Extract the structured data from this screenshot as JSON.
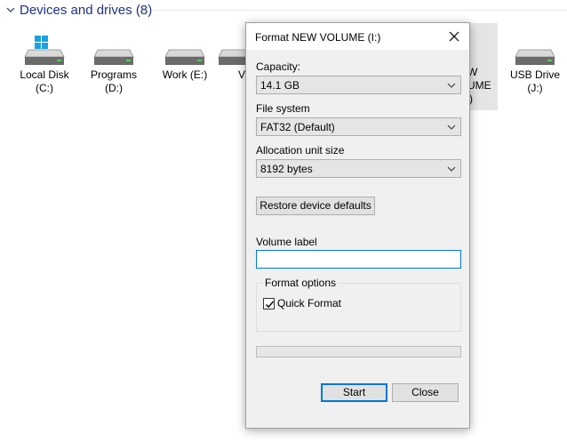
{
  "explorer": {
    "section_title": "Devices and drives (8)",
    "drives": [
      {
        "name": "Local Disk",
        "letter": "(C:)"
      },
      {
        "name": "Programs",
        "letter": "(D:)"
      },
      {
        "name": "Work (E:)",
        "letter": ""
      },
      {
        "name": "Vi",
        "letter": ""
      },
      {
        "name": "W",
        "letter": "UME",
        "extra": ")"
      },
      {
        "name": "USB Drive",
        "letter": "(J:)"
      }
    ]
  },
  "dialog": {
    "title": "Format NEW VOLUME (I:)",
    "capacity_label": "Capacity:",
    "capacity_value": "14.1 GB",
    "filesystem_label": "File system",
    "filesystem_value": "FAT32 (Default)",
    "allocation_label": "Allocation unit size",
    "allocation_value": "8192 bytes",
    "restore_button": "Restore device defaults",
    "volume_label_label": "Volume label",
    "volume_label_value": "",
    "format_options_legend": "Format options",
    "quick_format_label": "Quick Format",
    "quick_format_checked": true,
    "progress_fraction": 0,
    "start_button": "Start",
    "close_button": "Close"
  },
  "colors": {
    "accent": "#0078d7",
    "header_text": "#1e3287",
    "dialog_bg": "#f0f0f0"
  },
  "icons": [
    "chevron-down-icon",
    "windows-drive-icon",
    "drive-icon",
    "close-icon",
    "dropdown-arrow-icon",
    "checkmark-icon"
  ]
}
